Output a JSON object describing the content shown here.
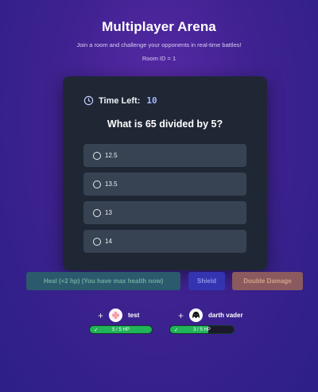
{
  "header": {
    "title": "Multiplayer Arena",
    "subtitle": "Join a room and challenge your opponents in real-time battles!",
    "room": "Room ID = 1"
  },
  "quiz": {
    "timer_label": "Time Left:",
    "timer_value": "10",
    "question": "What is 65 divided by 5?",
    "options": [
      {
        "label": "12.5"
      },
      {
        "label": "13.5"
      },
      {
        "label": "13"
      },
      {
        "label": "14"
      }
    ]
  },
  "powerups": {
    "heal_label": "Heal (+2 hp) (You have max health now)",
    "shield_label": "Shield",
    "double_label": "Double Damage"
  },
  "players": [
    {
      "name": "test",
      "hp_text": "5 / 5 HP",
      "hp_fraction": 1.0,
      "avatar_icon": "flower-avatar-icon"
    },
    {
      "name": "darth vader",
      "hp_text": "3 / 5 HP",
      "hp_fraction": 0.6,
      "avatar_icon": "darth-vader-avatar-icon"
    }
  ],
  "colors": {
    "accent": "#a8b4ff",
    "hp_green": "#21b459",
    "heal_bg": "#2a5a6c",
    "shield_bg": "#3434b0",
    "double_bg": "#8a5a5e"
  }
}
